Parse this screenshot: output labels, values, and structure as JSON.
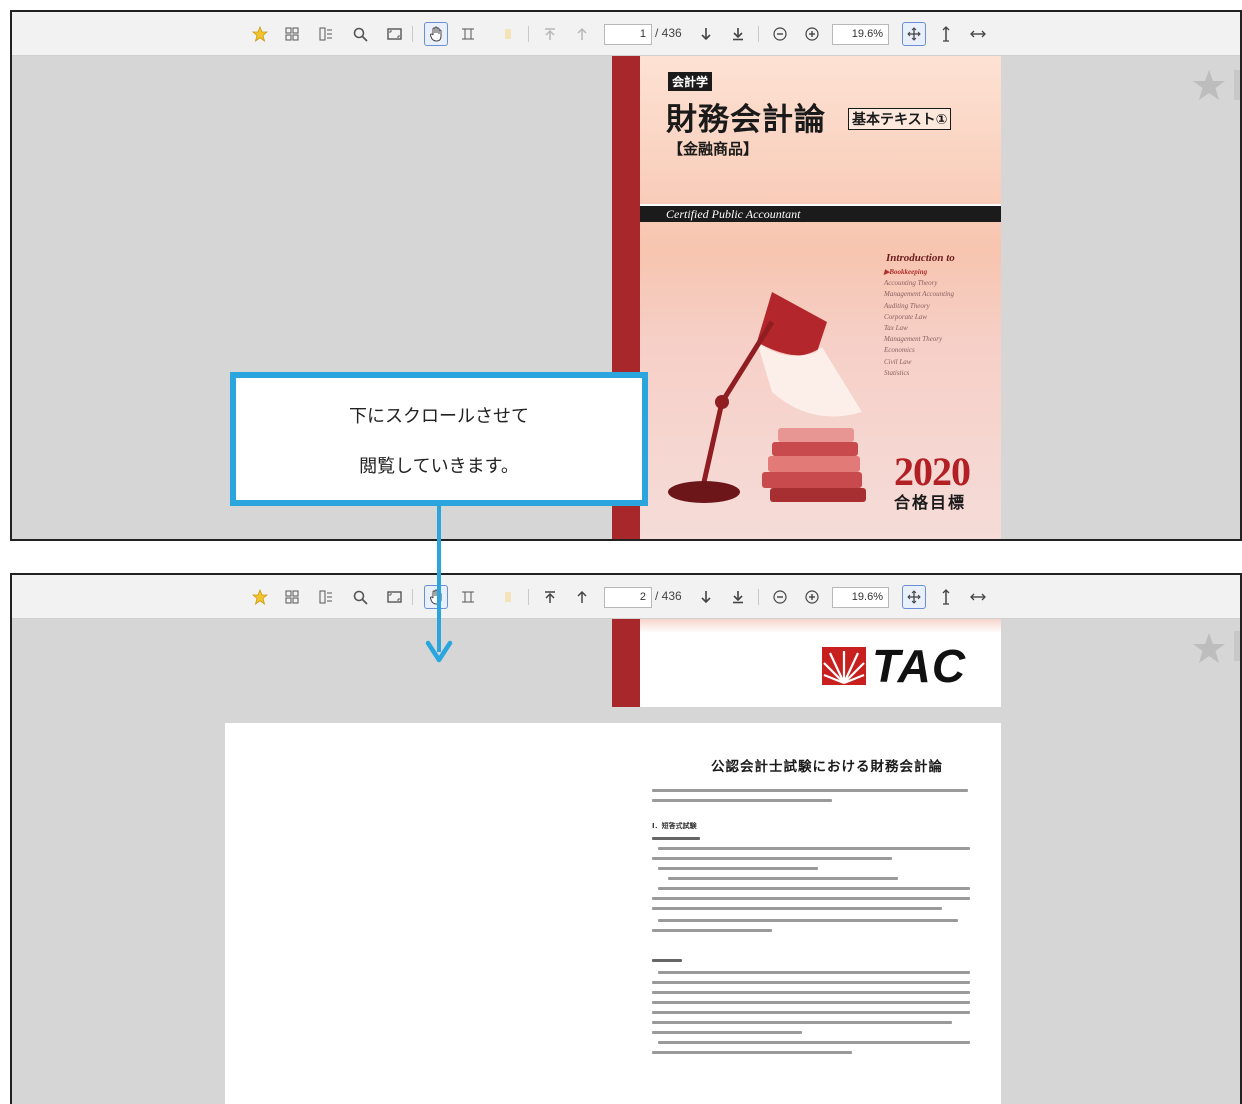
{
  "top_view": {
    "page_current": "1",
    "page_total": "/ 436",
    "zoom": "19.6%"
  },
  "bottom_view": {
    "page_current": "2",
    "page_total": "/ 436",
    "zoom": "19.6%"
  },
  "cover": {
    "badge": "会計学",
    "title": "財務会計論",
    "subtitle": "基本テキスト①",
    "genre": "【金融商品】",
    "band": "Certified Public Accountant",
    "intro": "Introduction to",
    "subjects": [
      "▶Bookkeeping",
      "Accounting Theory",
      "Management Accounting",
      "Auditing Theory",
      "Corporate Law",
      "Tax Law",
      "Management Theory",
      "Economics",
      "Civil Law",
      "Statistics"
    ],
    "year": "2020",
    "goal": "合格目標"
  },
  "callout": {
    "line1": "下にスクロールさせて",
    "line2": "閲覧していきます。"
  },
  "back_cover": {
    "logo_text": "TAC"
  },
  "doc": {
    "title": "公認会計士試験における財務会計論",
    "heading_1": "Ⅰ．短答式試験"
  },
  "colors": {
    "callout_border": "#2aa5dd",
    "spine": "#a7272b",
    "year": "#b21f24"
  },
  "icons": [
    "star-icon",
    "thumbnails-icon",
    "bookmarks-icon",
    "search-icon",
    "fit-page-icon",
    "hand-tool-icon",
    "select-tool-icon",
    "highlight-icon",
    "first-page-icon",
    "prev-page-icon",
    "next-page-icon",
    "last-page-icon",
    "zoom-out-icon",
    "zoom-in-icon",
    "fit-width-icon",
    "vertical-scroll-icon",
    "horizontal-scroll-icon"
  ]
}
